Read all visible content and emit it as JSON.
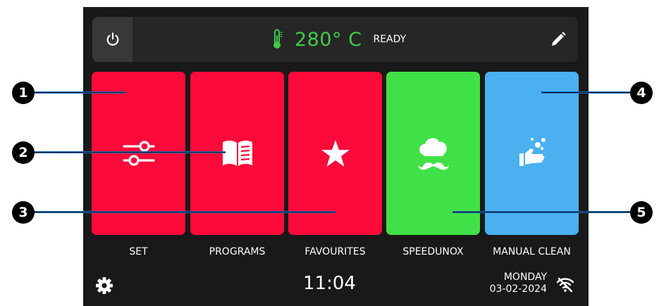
{
  "header": {
    "temperature": "280° C",
    "status": "READY"
  },
  "tiles": [
    {
      "label": "SET",
      "color": "#fb0a3a",
      "icon": "sliders-icon"
    },
    {
      "label": "PROGRAMS",
      "color": "#fb0a3a",
      "icon": "book-icon"
    },
    {
      "label": "FAVOURITES",
      "color": "#fb0a3a",
      "icon": "star-icon"
    },
    {
      "label": "SPEEDUNOX",
      "color": "#40e146",
      "icon": "chef-hat-icon"
    },
    {
      "label": "MANUAL CLEAN",
      "color": "#4ab0f0",
      "icon": "hand-wash-icon"
    }
  ],
  "footer": {
    "time": "11:04",
    "day": "MONDAY",
    "date": "03-02-2024"
  },
  "callouts": [
    "1",
    "2",
    "3",
    "4",
    "5"
  ],
  "colors": {
    "screen_bg": "#191919",
    "topbar_bg": "#262626",
    "accent_green": "#3ecb4a",
    "callout_line": "#1a72c7"
  }
}
